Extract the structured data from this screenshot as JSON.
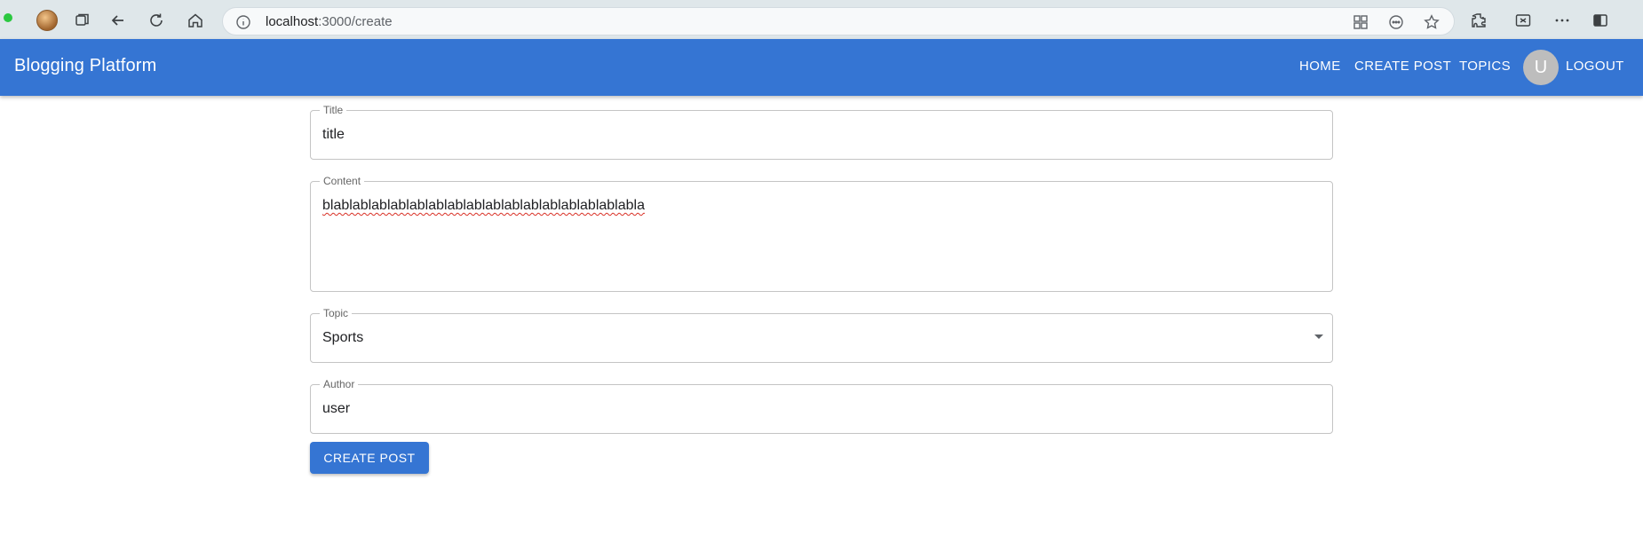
{
  "browser": {
    "url_host": "localhost",
    "url_path": ":3000/create",
    "icons": [
      "profile-avatar",
      "tabs-icon",
      "back-icon",
      "reload-icon",
      "home-icon",
      "info-icon",
      "apps-icon",
      "reader-icon",
      "favorite-star-icon",
      "extensions-icon",
      "collections-icon",
      "more-icon",
      "sidebar-icon"
    ]
  },
  "app": {
    "title": "Blogging Platform",
    "nav": {
      "home": "HOME",
      "create_post": "CREATE POST",
      "topics": "TOPICS",
      "avatar_initial": "U",
      "logout": "LOGOUT"
    },
    "colors": {
      "primary": "#3575d3",
      "avatar": "#bdbdbd"
    }
  },
  "form": {
    "title": {
      "label": "Title",
      "value": "title"
    },
    "content": {
      "label": "Content",
      "value": "blablablablablablablablablablablablablablablablabla"
    },
    "topic": {
      "label": "Topic",
      "value": "Sports"
    },
    "author": {
      "label": "Author",
      "value": "user"
    },
    "submit_label": "CREATE POST"
  }
}
